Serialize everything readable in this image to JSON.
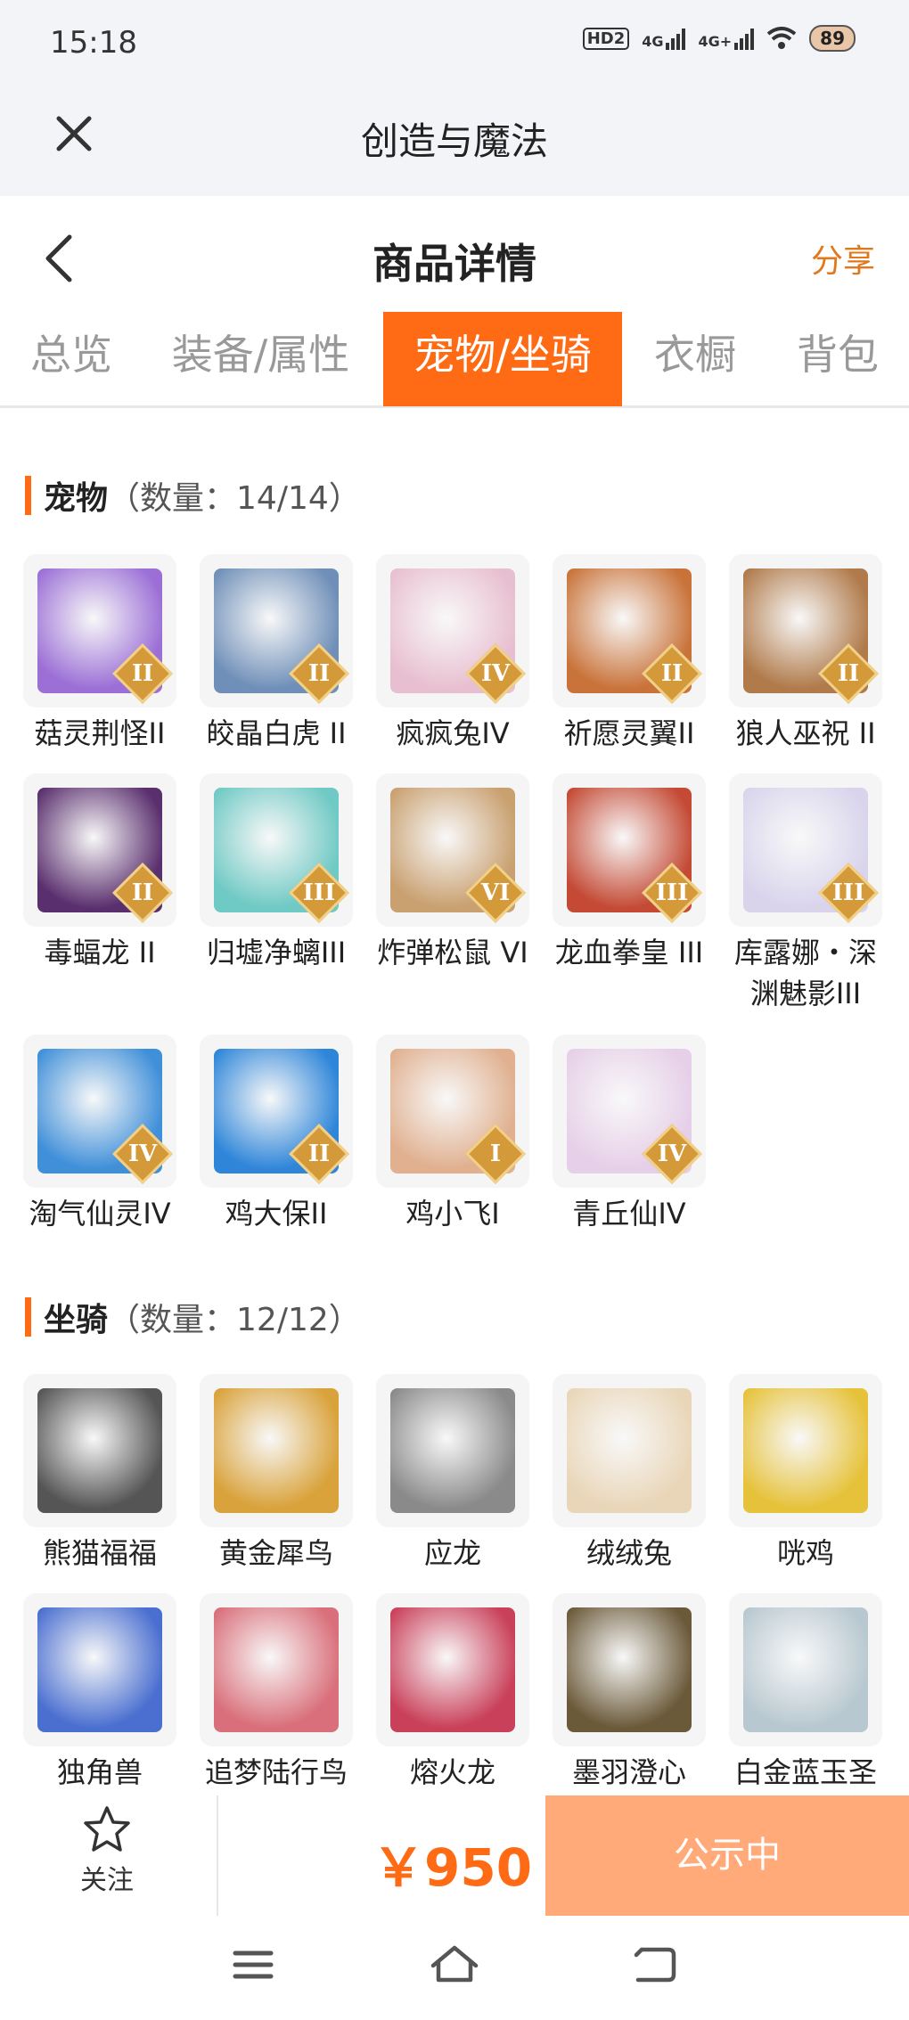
{
  "status": {
    "time": "15:18",
    "hd": "HD2",
    "net1": "4G",
    "net2": "4G+",
    "battery": "89"
  },
  "app": {
    "title": "创造与魔法"
  },
  "header": {
    "title": "商品详情",
    "share": "分享"
  },
  "tabs": [
    {
      "label": "总览"
    },
    {
      "label": "装备/属性"
    },
    {
      "label": "宠物/坐骑",
      "active": true
    },
    {
      "label": "衣橱"
    },
    {
      "label": "背包"
    }
  ],
  "pets": {
    "name": "宠物",
    "count": "（数量：14/14）",
    "items": [
      {
        "name": "菇灵荆怪II",
        "rank": "II",
        "color": "#9b6fd6",
        "icon": "mushroom-sprite-icon"
      },
      {
        "name": "皎晶白虎 II",
        "rank": "II",
        "color": "#6f8fb8",
        "icon": "white-tiger-icon"
      },
      {
        "name": "疯疯兔IV",
        "rank": "IV",
        "color": "#e8bfd0",
        "icon": "crazy-rabbit-icon"
      },
      {
        "name": "祈愿灵翼II",
        "rank": "II",
        "color": "#c9733a",
        "icon": "griffin-icon"
      },
      {
        "name": "狼人巫祝 II",
        "rank": "II",
        "color": "#b07a4a",
        "icon": "werewolf-icon"
      },
      {
        "name": "毒蝠龙 II",
        "rank": "II",
        "color": "#5a2f6e",
        "icon": "bat-dragon-icon"
      },
      {
        "name": "归墟净螭III",
        "rank": "III",
        "color": "#6fc9c4",
        "icon": "water-dragon-icon"
      },
      {
        "name": "炸弹松鼠 VI",
        "rank": "VI",
        "color": "#c9a070",
        "icon": "bomb-squirrel-icon"
      },
      {
        "name": "龙血拳皇 III",
        "rank": "III",
        "color": "#c44a35",
        "icon": "dragon-fist-icon"
      },
      {
        "name": "库露娜・深渊魅影III",
        "rank": "III",
        "color": "#d9d4ec",
        "icon": "kuluna-icon"
      },
      {
        "name": "淘气仙灵IV",
        "rank": "IV",
        "color": "#3f8fd9",
        "icon": "naughty-fairy-icon"
      },
      {
        "name": "鸡大保II",
        "rank": "II",
        "color": "#2f86d9",
        "icon": "blue-chicken-icon"
      },
      {
        "name": "鸡小飞I",
        "rank": "I",
        "color": "#e0b08f",
        "icon": "chick-icon"
      },
      {
        "name": "青丘仙IV",
        "rank": "IV",
        "color": "#e6cfe8",
        "icon": "fox-fairy-icon"
      }
    ]
  },
  "mounts": {
    "name": "坐骑",
    "count": "（数量：12/12）",
    "items": [
      {
        "name": "熊猫福福",
        "color": "#555555",
        "icon": "panda-icon"
      },
      {
        "name": "黄金犀鸟",
        "color": "#d9a23a",
        "icon": "hornbill-icon"
      },
      {
        "name": "应龙",
        "color": "#8a8a8a",
        "icon": "ying-dragon-icon"
      },
      {
        "name": "绒绒兔",
        "color": "#e9d6b8",
        "icon": "fluffy-rabbit-icon"
      },
      {
        "name": "咣鸡",
        "color": "#e6c23a",
        "icon": "yellow-chicken-icon"
      },
      {
        "name": "独角兽",
        "color": "#4a6fd0",
        "icon": "unicorn-icon"
      },
      {
        "name": "追梦陆行鸟",
        "color": "#d96f7a",
        "icon": "dream-bird-icon"
      },
      {
        "name": "熔火龙",
        "color": "#c9405a",
        "icon": "lava-dragon-icon"
      },
      {
        "name": "墨羽澄心",
        "color": "#6b5a3a",
        "icon": "feather-staff-icon"
      },
      {
        "name": "白金蓝玉圣",
        "color": "#b8c8d0",
        "icon": "platinum-mask-icon"
      }
    ]
  },
  "bottom": {
    "follow": "关注",
    "price": "￥950",
    "status": "公示中"
  }
}
